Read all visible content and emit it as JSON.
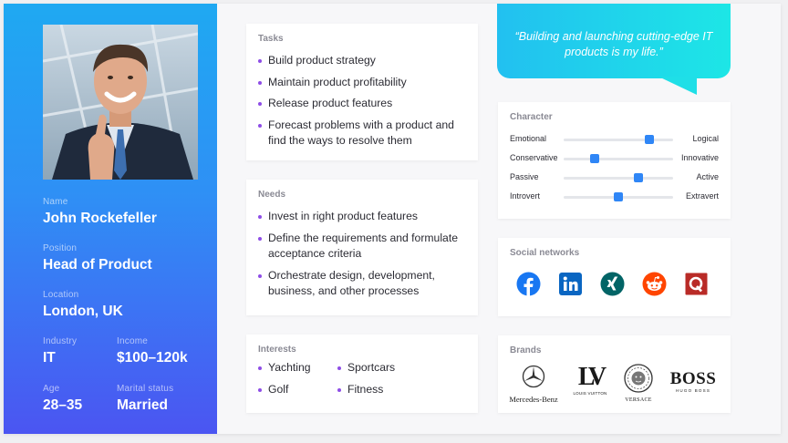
{
  "profile": {
    "name_label": "Name",
    "name": "John Rockefeller",
    "position_label": "Position",
    "position": "Head of Product",
    "location_label": "Location",
    "location": "London, UK",
    "industry_label": "Industry",
    "industry": "IT",
    "income_label": "Income",
    "income": "$100–120k",
    "age_label": "Age",
    "age": "28–35",
    "marital_label": "Marital status",
    "marital": "Married"
  },
  "tasks": {
    "title": "Tasks",
    "items": [
      "Build product strategy",
      "Maintain product profitability",
      "Release product features",
      "Forecast problems with a product and find the ways to resolve them"
    ]
  },
  "needs": {
    "title": "Needs",
    "items": [
      "Invest in right product features",
      "Define the requirements and formulate acceptance criteria",
      "Orchestrate design, development, business, and other processes"
    ]
  },
  "interests": {
    "title": "Interests",
    "items": [
      "Yachting",
      "Sportcars",
      "Golf",
      "Fitness"
    ]
  },
  "quote": "“Building and launching cutting-edge IT products is my life.”",
  "character": {
    "title": "Character",
    "traits": [
      {
        "left": "Emotional",
        "right": "Logical",
        "value": 0.78
      },
      {
        "left": "Conservative",
        "right": "Innovative",
        "value": 0.28
      },
      {
        "left": "Passive",
        "right": "Active",
        "value": 0.68
      },
      {
        "left": "Introvert",
        "right": "Extravert",
        "value": 0.5
      }
    ]
  },
  "social": {
    "title": "Social networks",
    "networks": [
      "facebook-icon",
      "linkedin-icon",
      "xing-icon",
      "reddit-icon",
      "quora-icon"
    ],
    "colors": {
      "facebook": "#1877f2",
      "linkedin": "#0a66c2",
      "xing": "#026466",
      "reddit": "#ff4500",
      "quora": "#b92b27"
    }
  },
  "brands": {
    "title": "Brands",
    "items": [
      "Mercedes-Benz",
      "LOUIS VUITTON",
      "VERSACE",
      "BOSS",
      "HUGO BOSS"
    ],
    "lv_mark": "LV"
  },
  "colors": {
    "accent": "#8e4de6",
    "slider": "#2f86f6",
    "panel_top": "#1fa9f2",
    "panel_bottom": "#4b55f2"
  }
}
